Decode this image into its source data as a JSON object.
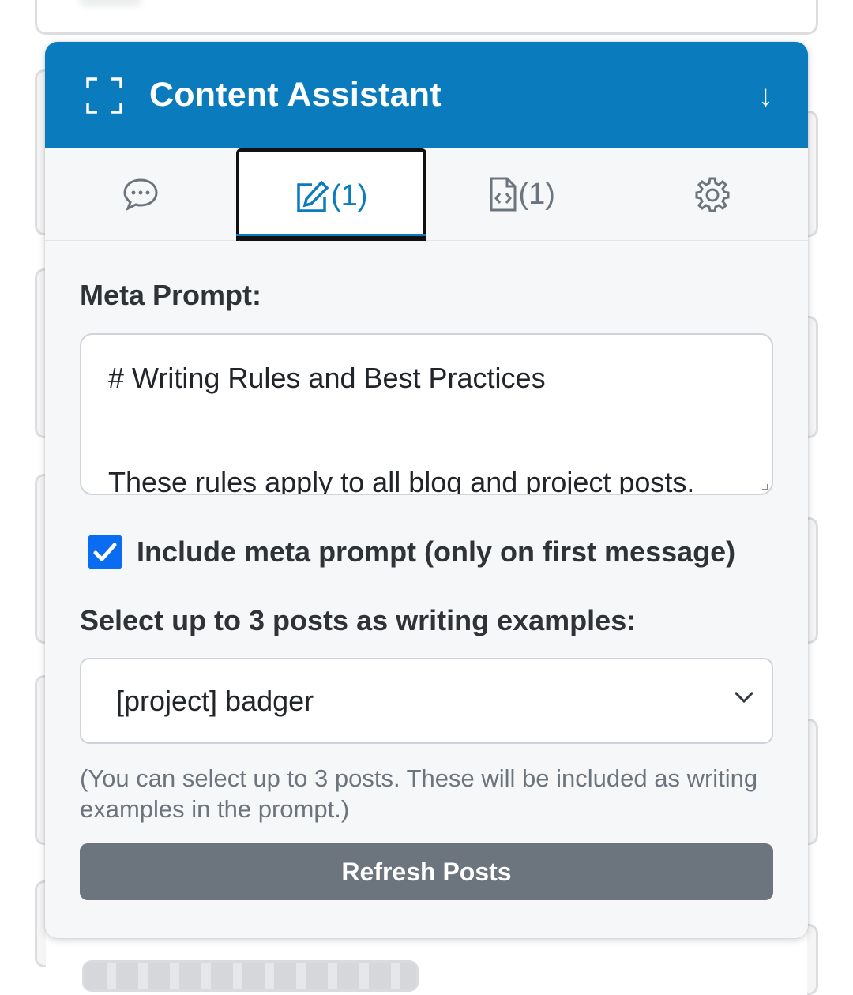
{
  "header": {
    "title": "Content Assistant",
    "expand_icon": "expand-icon",
    "collapse_icon": "arrow-down-icon",
    "accent_color": "#0a7cbd"
  },
  "tabs": [
    {
      "icon": "chat-bubble-icon",
      "count": ""
    },
    {
      "icon": "edit-icon",
      "count": "(1)",
      "active": true
    },
    {
      "icon": "code-file-icon",
      "count": "(1)"
    },
    {
      "icon": "gear-icon",
      "count": ""
    }
  ],
  "meta_prompt": {
    "label": "Meta Prompt:",
    "line1": "# Writing Rules and Best Practices",
    "line2": "These rules apply to all blog and project posts."
  },
  "include_checkbox": {
    "checked": true,
    "label": "Include meta prompt (only on first message)"
  },
  "examples": {
    "label": "Select up to 3 posts as writing examples:",
    "selected": "[project] badger",
    "help": "(You can select up to 3 posts. These will be included as writing examples in the prompt.)"
  },
  "refresh_button": {
    "label": "Refresh Posts",
    "color": "#6c757d"
  }
}
